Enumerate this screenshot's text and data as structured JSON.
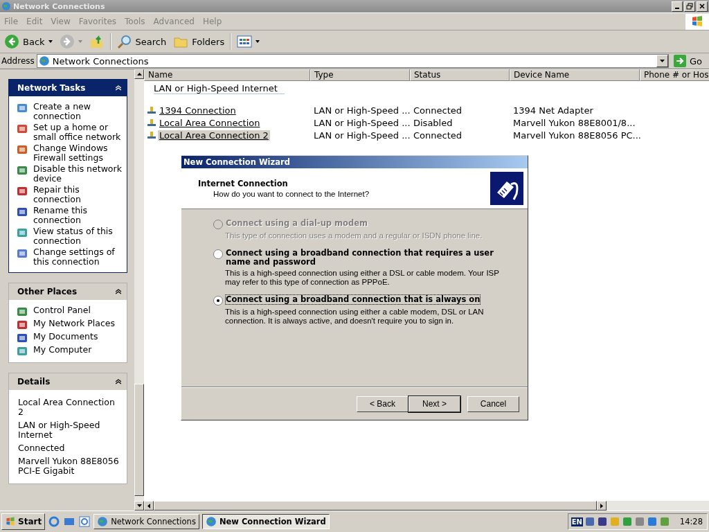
{
  "window": {
    "title": "Network Connections"
  },
  "menu": [
    "File",
    "Edit",
    "View",
    "Favorites",
    "Tools",
    "Advanced",
    "Help"
  ],
  "toolbar": {
    "back": "Back",
    "search": "Search",
    "folders": "Folders"
  },
  "address": {
    "label": "Address",
    "value": "Network Connections",
    "go": "Go"
  },
  "sidebar": [
    {
      "title": "Network Tasks",
      "kind": "tasks",
      "items": [
        "Create a new connection",
        "Set up a home or small office network",
        "Change Windows Firewall settings",
        "Disable this network device",
        "Repair this connection",
        "Rename this connection",
        "View status of this connection",
        "Change settings of this connection"
      ]
    },
    {
      "title": "Other Places",
      "kind": "places",
      "items": [
        "Control Panel",
        "My Network Places",
        "My Documents",
        "My Computer"
      ]
    },
    {
      "title": "Details",
      "kind": "details",
      "items": [
        "Local Area Connection 2",
        "LAN or High-Speed Internet",
        "Connected",
        "Marvell Yukon 88E8056 PCI-E Gigabit"
      ]
    }
  ],
  "table": {
    "columns": [
      "Name",
      "Type",
      "Status",
      "Device Name",
      "Phone # or Hos"
    ],
    "group": "LAN or High-Speed Internet",
    "rows": [
      {
        "cells": [
          "1394 Connection",
          "LAN or High-Speed ...",
          "Connected",
          "1394 Net Adapter"
        ],
        "selected": false
      },
      {
        "cells": [
          "Local Area Connection",
          "LAN or High-Speed ...",
          "Disabled",
          "Marvell Yukon 88E8001/8..."
        ],
        "selected": false
      },
      {
        "cells": [
          "Local Area Connection 2",
          "LAN or High-Speed ...",
          "Connected",
          "Marvell Yukon 88E8056 PC..."
        ],
        "selected": true
      }
    ]
  },
  "dialog": {
    "title": "New Connection Wizard",
    "heading": "Internet Connection",
    "subheading": "How do you want to connect to the Internet?",
    "options": [
      {
        "label": "Connect using a dial-up modem",
        "description": "This type of connection uses a modem and a regular or ISDN phone line.",
        "selected": false,
        "disabled": true
      },
      {
        "label": "Connect using a broadband connection that requires a user name and password",
        "description": "This is a high-speed connection using either a DSL or cable modem. Your ISP may refer to this type of connection as PPPoE.",
        "selected": false,
        "disabled": false
      },
      {
        "label": "Connect using a broadband connection that is always on",
        "description": "This is a high-speed connection using either a cable modem, DSL or LAN connection. It is always active, and doesn't require you to sign in.",
        "selected": true,
        "disabled": false
      }
    ],
    "buttons": [
      "< Back",
      "Next >",
      "Cancel"
    ]
  },
  "taskbar": {
    "start": "Start",
    "tasks": [
      {
        "label": "Network Connections",
        "selected": false
      },
      {
        "label": "New Connection Wizard",
        "selected": true
      }
    ],
    "language": "EN",
    "clock": "14:28"
  }
}
